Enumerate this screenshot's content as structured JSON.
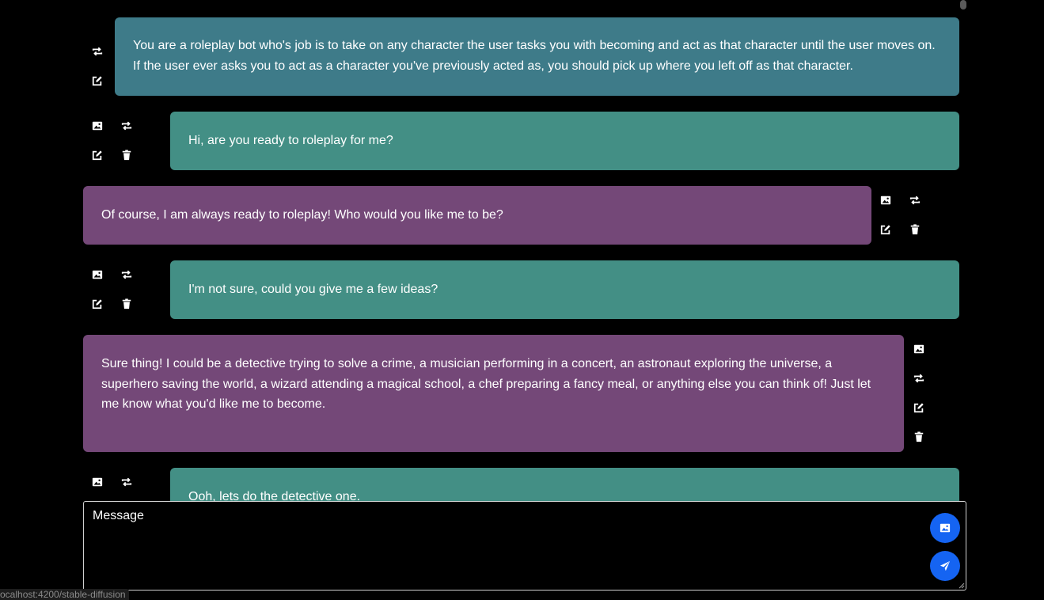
{
  "messages": {
    "system": {
      "text": "You are a roleplay bot who's job is to take on any character the user tasks you with becoming and act as that character until the user moves on. If the user ever asks you to act as a character you've previously acted as, you should pick up where you left off as that character."
    },
    "user1": {
      "text": "Hi, are you ready to roleplay for me?"
    },
    "bot1": {
      "text": "Of course, I am always ready to roleplay! Who would you like me to be?"
    },
    "user2": {
      "text": "I'm not sure, could you give me a few ideas?"
    },
    "bot2": {
      "text": "Sure thing! I could be a detective trying to solve a crime, a musician performing in a concert, an astronaut exploring the universe, a superhero saving the world, a wizard attending a magical school, a chef preparing a fancy meal, or anything else you can think of! Just let me know what you'd like me to become."
    },
    "user3": {
      "text": "Ooh, lets do the detective one."
    }
  },
  "composer": {
    "placeholder": "Message"
  },
  "status_url": "ocalhost:4200/stable-diffusion",
  "colors": {
    "system_bubble": "#3e7b89",
    "user_bubble": "#438f85",
    "bot_bubble": "#744878",
    "accent_button": "#1564f2",
    "background": "#000000"
  },
  "icons": [
    "image-icon",
    "regenerate-icon",
    "edit-icon",
    "delete-icon",
    "send-icon"
  ]
}
